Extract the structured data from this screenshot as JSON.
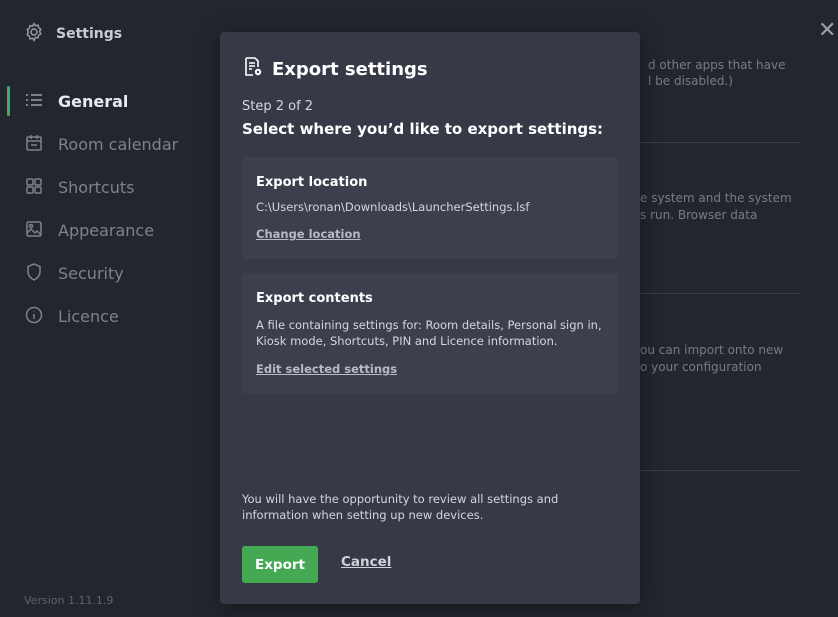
{
  "app": {
    "title": "Settings",
    "version": "Version 1.11.1.9"
  },
  "sidebar": {
    "items": [
      {
        "label": "General",
        "icon": "list-icon",
        "active": true
      },
      {
        "label": "Room calendar",
        "icon": "calendar-icon",
        "active": false
      },
      {
        "label": "Shortcuts",
        "icon": "grid-icon",
        "active": false
      },
      {
        "label": "Appearance",
        "icon": "image-icon",
        "active": false
      },
      {
        "label": "Security",
        "icon": "shield-icon",
        "active": false
      },
      {
        "label": "Licence",
        "icon": "info-icon",
        "active": false
      }
    ]
  },
  "background": {
    "text1": "d other apps that have",
    "text2": "l be disabled.)",
    "text3": "e system and the system",
    "text4": "s run. Browser data",
    "text5": "ou can import onto new",
    "text6": "o your configuration"
  },
  "modal": {
    "title": "Export settings",
    "step": "Step 2 of 2",
    "subtitle": "Select where you’d like to export settings:",
    "location": {
      "title": "Export location",
      "path": "C:\\Users\\ronan\\Downloads\\LauncherSettings.lsf",
      "link": "Change location"
    },
    "contents": {
      "title": "Export contents",
      "line1": "A file containing settings for: Room details, Personal sign in,",
      "line2": "Kiosk mode, Shortcuts, PIN and Licence information.",
      "link": "Edit selected settings"
    },
    "note_line1": "You will have the opportunity to review all settings and",
    "note_line2": "information when setting up new devices.",
    "export_label": "Export",
    "cancel_label": "Cancel"
  },
  "colors": {
    "accent": "#45a852",
    "background": "#23262f",
    "modal": "#363a47",
    "card": "#3b404c"
  }
}
